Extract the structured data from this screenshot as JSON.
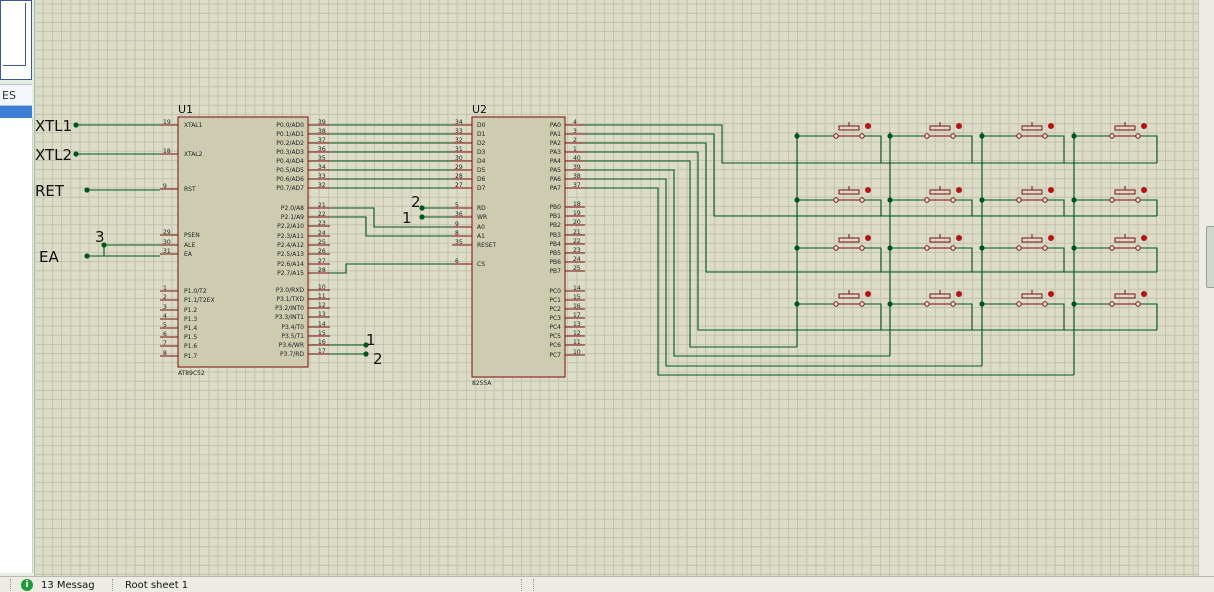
{
  "left_panel": {
    "tab_label": "ES"
  },
  "status": {
    "icon": "info-icon",
    "icon_glyph": "i",
    "messages": "13 Messag",
    "sheet": "Root sheet 1"
  },
  "nets": [
    "XTL1",
    "XTL2",
    "RET",
    "EA"
  ],
  "marker_numbers": {
    "ea_marker": "3",
    "rd_marker": "2",
    "wr_marker": "1",
    "p36_marker": "1",
    "p37_marker": "2"
  },
  "u1": {
    "ref": "U1",
    "part": "AT89C52",
    "left_pins": [
      {
        "name": "XTAL1",
        "num": "19"
      },
      {
        "name": "XTAL2",
        "num": "18"
      },
      {
        "name": "RST",
        "num": "9"
      },
      {
        "name": "PSEN",
        "num": "29"
      },
      {
        "name": "ALE",
        "num": "30"
      },
      {
        "name": "EA",
        "num": "31"
      },
      {
        "name": "P1.0/T2",
        "num": "1"
      },
      {
        "name": "P1.1/T2EX",
        "num": "2"
      },
      {
        "name": "P1.2",
        "num": "3"
      },
      {
        "name": "P1.3",
        "num": "4"
      },
      {
        "name": "P1.4",
        "num": "5"
      },
      {
        "name": "P1.5",
        "num": "6"
      },
      {
        "name": "P1.6",
        "num": "7"
      },
      {
        "name": "P1.7",
        "num": "8"
      }
    ],
    "right_pins": [
      {
        "name": "P0.0/AD0",
        "num": "39"
      },
      {
        "name": "P0.1/AD1",
        "num": "38"
      },
      {
        "name": "P0.2/AD2",
        "num": "37"
      },
      {
        "name": "P0.3/AD3",
        "num": "36"
      },
      {
        "name": "P0.4/AD4",
        "num": "35"
      },
      {
        "name": "P0.5/AD5",
        "num": "34"
      },
      {
        "name": "P0.6/AD6",
        "num": "33"
      },
      {
        "name": "P0.7/AD7",
        "num": "32"
      },
      {
        "name": "P2.0/A8",
        "num": "21"
      },
      {
        "name": "P2.1/A9",
        "num": "22"
      },
      {
        "name": "P2.2/A10",
        "num": "23"
      },
      {
        "name": "P2.3/A11",
        "num": "24"
      },
      {
        "name": "P2.4/A12",
        "num": "25"
      },
      {
        "name": "P2.5/A13",
        "num": "26"
      },
      {
        "name": "P2.6/A14",
        "num": "27"
      },
      {
        "name": "P2.7/A15",
        "num": "28"
      },
      {
        "name": "P3.0/RXD",
        "num": "10"
      },
      {
        "name": "P3.1/TXD",
        "num": "11"
      },
      {
        "name": "P3.2/INT0",
        "num": "12"
      },
      {
        "name": "P3.3/INT1",
        "num": "13"
      },
      {
        "name": "P3.4/T0",
        "num": "14"
      },
      {
        "name": "P3.5/T1",
        "num": "15"
      },
      {
        "name": "P3.6/WR",
        "num": "16"
      },
      {
        "name": "P3.7/RD",
        "num": "17"
      }
    ]
  },
  "u2": {
    "ref": "U2",
    "part": "8255A",
    "left_pins": [
      {
        "name": "D0",
        "num": "34"
      },
      {
        "name": "D1",
        "num": "33"
      },
      {
        "name": "D2",
        "num": "32"
      },
      {
        "name": "D3",
        "num": "31"
      },
      {
        "name": "D4",
        "num": "30"
      },
      {
        "name": "D5",
        "num": "29"
      },
      {
        "name": "D6",
        "num": "28"
      },
      {
        "name": "D7",
        "num": "27"
      },
      {
        "name": "RD",
        "num": "5"
      },
      {
        "name": "WR",
        "num": "36"
      },
      {
        "name": "A0",
        "num": "9"
      },
      {
        "name": "A1",
        "num": "8"
      },
      {
        "name": "RESET",
        "num": "35"
      },
      {
        "name": "CS",
        "num": "6"
      }
    ],
    "right_pins": [
      {
        "name": "PA0",
        "num": "4"
      },
      {
        "name": "PA1",
        "num": "3"
      },
      {
        "name": "PA2",
        "num": "2"
      },
      {
        "name": "PA3",
        "num": "1"
      },
      {
        "name": "PA4",
        "num": "40"
      },
      {
        "name": "PA5",
        "num": "39"
      },
      {
        "name": "PA6",
        "num": "38"
      },
      {
        "name": "PA7",
        "num": "37"
      },
      {
        "name": "PB0",
        "num": "18"
      },
      {
        "name": "PB1",
        "num": "19"
      },
      {
        "name": "PB2",
        "num": "20"
      },
      {
        "name": "PB3",
        "num": "21"
      },
      {
        "name": "PB4",
        "num": "22"
      },
      {
        "name": "PB5",
        "num": "23"
      },
      {
        "name": "PB6",
        "num": "24"
      },
      {
        "name": "PB7",
        "num": "25"
      },
      {
        "name": "PC0",
        "num": "14"
      },
      {
        "name": "PC1",
        "num": "15"
      },
      {
        "name": "PC2",
        "num": "16"
      },
      {
        "name": "PC3",
        "num": "17"
      },
      {
        "name": "PC4",
        "num": "13"
      },
      {
        "name": "PC5",
        "num": "12"
      },
      {
        "name": "PC6",
        "num": "11"
      },
      {
        "name": "PC7",
        "num": "10"
      }
    ]
  },
  "keypad": {
    "rows": 4,
    "cols": 4
  },
  "colors": {
    "wire": "#00561b",
    "component": "#7a0d0d",
    "chip_fill": "#cdcbb0",
    "grid": "#c3c3aa",
    "background": "#dcdcc8"
  }
}
